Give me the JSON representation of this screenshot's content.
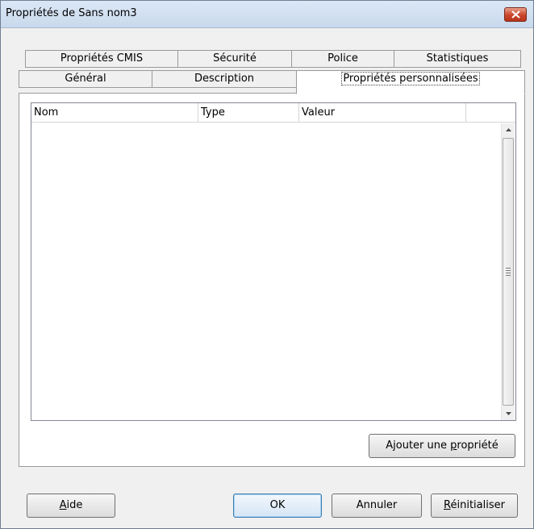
{
  "window": {
    "title": "Propriétés de Sans nom3"
  },
  "tabs": {
    "row1": [
      "Propriétés CMIS",
      "Sécurité",
      "Police",
      "Statistiques"
    ],
    "row2": [
      "Général",
      "Description",
      "Propriétés personnalisées"
    ],
    "active": "Propriétés personnalisées"
  },
  "table": {
    "columns": [
      "Nom",
      "Type",
      "Valeur"
    ]
  },
  "buttons": {
    "add_property": {
      "pre": "Ajouter une ",
      "accel": "p",
      "post": "ropriété"
    },
    "help": {
      "pre": "",
      "accel": "A",
      "post": "ide"
    },
    "ok": "OK",
    "cancel": "Annuler",
    "reset": {
      "pre": "",
      "accel": "R",
      "post": "éinitialiser"
    }
  },
  "icons": {
    "close": "close-icon",
    "scroll_up": "scroll-up-arrow-icon",
    "scroll_down": "scroll-down-arrow-icon",
    "grip": "scrollbar-grip-icon"
  }
}
